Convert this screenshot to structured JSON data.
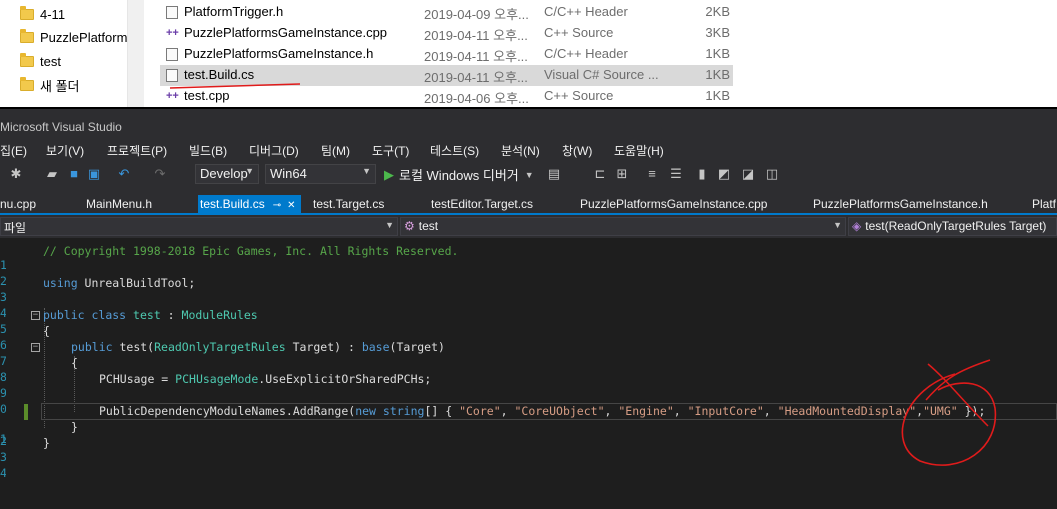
{
  "explorer": {
    "folders": [
      {
        "label": "4-11"
      },
      {
        "label": "PuzzlePlatforms"
      },
      {
        "label": "test"
      },
      {
        "label": "새 폴더"
      }
    ],
    "files": [
      {
        "name": "PlatformTrigger.h",
        "date": "2019-04-09 오후...",
        "type": "C/C++ Header",
        "size": "2KB",
        "icon": "header-file-icon"
      },
      {
        "name": "PuzzlePlatformsGameInstance.cpp",
        "date": "2019-04-11 오후...",
        "type": "C++ Source",
        "size": "3KB",
        "icon": "cpp-file-icon"
      },
      {
        "name": "PuzzlePlatformsGameInstance.h",
        "date": "2019-04-11 오후...",
        "type": "C/C++ Header",
        "size": "1KB",
        "icon": "header-file-icon"
      },
      {
        "name": "test.Build.cs",
        "date": "2019-04-11 오후...",
        "type": "Visual C# Source ...",
        "size": "1KB",
        "icon": "cs-file-icon"
      },
      {
        "name": "test.cpp",
        "date": "2019-04-06 오후...",
        "type": "C++ Source",
        "size": "1KB",
        "icon": "cpp-file-icon"
      }
    ]
  },
  "vs": {
    "title": "Microsoft Visual Studio",
    "menu": [
      "집(E)",
      "보기(V)",
      "프로젝트(P)",
      "빌드(B)",
      "디버그(D)",
      "팀(M)",
      "도구(T)",
      "테스트(S)",
      "분석(N)",
      "창(W)",
      "도움말(H)"
    ],
    "toolbar": {
      "config": "Develop",
      "platform": "Win64",
      "run_label": "로컬 Windows 디버거"
    },
    "tabs": [
      "nu.cpp",
      "MainMenu.h",
      "test.Build.cs",
      "test.Target.cs",
      "testEditor.Target.cs",
      "PuzzlePlatformsGameInstance.cpp",
      "PuzzlePlatformsGameInstance.h",
      "Platf"
    ],
    "navbar": {
      "project": "파일",
      "class": "test",
      "member": "test(ReadOnlyTargetRules Target)"
    },
    "code": {
      "line_numbers": [
        "1",
        "2",
        "3",
        "4",
        "5",
        "6",
        "7",
        "8",
        "9",
        "0",
        "1",
        "2",
        "3",
        "4"
      ],
      "comment": "// Copyright 1998-2018 Epic Games, Inc. All Rights Reserved.",
      "using_kw": "using",
      "using_ns": " UnrealBuildTool;",
      "public_kw": "public",
      "class_kw": "class",
      "class_name": "test",
      "base_sep": " : ",
      "base_type": "ModuleRules",
      "open_brace": "{",
      "close_brace": "}",
      "ctor_public": "public",
      "ctor_name": " test(",
      "ctor_param_type": "ReadOnlyTargetRules",
      "ctor_param": " Target) : ",
      "base_kw": "base",
      "base_arg": "(Target)",
      "pch_text": "PCHUsage = ",
      "pch_type": "PCHUsageMode",
      "pch_value": ".UseExplicitOrSharedPCHs;",
      "dep_text": "PublicDependencyModuleNames.AddRange(",
      "new_kw": "new",
      "string_kw": "string",
      "array_open": "[] { ",
      "dep_strings": [
        "\"Core\"",
        "\"CoreUObject\"",
        "\"Engine\"",
        "\"InputCore\"",
        "\"HeadMountedDisplay\"",
        "\"UMG\""
      ],
      "array_close": " });"
    }
  },
  "colors": {
    "accent": "#007acc",
    "annotation": "#e01b1b",
    "comment": "#57a64a",
    "keyword": "#569cd6",
    "type": "#4ec9b0",
    "string": "#d69d85"
  }
}
